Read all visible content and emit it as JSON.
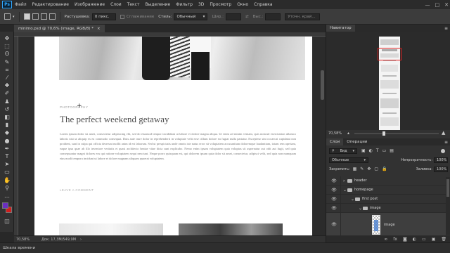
{
  "app": {
    "logo": "Ps"
  },
  "menu": [
    "Файл",
    "Редактирование",
    "Изображение",
    "Слои",
    "Текст",
    "Выделение",
    "Фильтр",
    "3D",
    "Просмотр",
    "Окно",
    "Справка"
  ],
  "window_controls": [
    "—",
    "□",
    "✕"
  ],
  "options_bar": {
    "feather_label": "Растушевка:",
    "feather_value": "0 пикс.",
    "antialias_label": "Сглаживание",
    "style_label": "Стиль:",
    "style_value": "Обычный",
    "width_label": "Шир.:",
    "height_label": "Выс.:",
    "refine_button": "Уточн. край..."
  },
  "document": {
    "tab_title": "minimo.psd @ 70,6% (image, RGB/8) *",
    "close_glyph": "×",
    "post_category": "PHOTOGRAPHY",
    "post_title": "The perfect weekend getaway",
    "post_body": "Lorem ipsum dolor sit amet, consectetur adipisicing elit, sed do eiusmod tempor incididunt ut labore et dolore magna aliqua. Ut enim ad minim veniam, quis nostrud exercitation ullamco laboris nisi ut aliquip ex ea commodo consequat. Duis aute irure dolor in reprehenderit in voluptate velit esse cillum dolore eu fugiat nulla pariatur. Excepteur sint occaecat cupidatat non proident, sunt in culpa qui officia deserunt mollit anim id est laborum. Sed ut perspiciatis unde omnis iste natus error sit voluptatem accusantium doloremque laudantium, totam rem aperiam, eaque ipsa quae ab illo inventore veritatis et quasi architecto beatae vitae dicta sunt explicabo. Nemo enim ipsam voluptatem quia voluptas sit aspernatur aut odit aut fugit, sed quia consequuntur magni dolores eos qui ratione voluptatem sequi nesciunt. Neque porro quisquam est, qui dolorem ipsum quia dolor sit amet, consectetur, adipisci velit, sed quia non numquam eius modi tempora incidunt ut labore et dolore magnam aliquam quaerat voluptatem.",
    "leave_comment": "LEAVE A COMMENT"
  },
  "status": {
    "zoom": "70,58%",
    "doc_size": "Док: 17,3M/549,9M",
    "arrow": "›"
  },
  "timeline": {
    "label": "Шкала времени"
  },
  "navigator": {
    "tab": "Навигатор",
    "zoom": "70,58%",
    "zoom_fraction": 0.35
  },
  "layers_panel": {
    "tabs": [
      "Слои",
      "Операции"
    ],
    "kind_filter": "Вид",
    "blend_mode": "Обычные",
    "opacity_label": "Непрозрачность:",
    "opacity_value": "100%",
    "lock_label": "Закрепить:",
    "fill_label": "Заливка:",
    "fill_value": "100%",
    "layers": [
      {
        "name": "header",
        "type": "folder",
        "indent": 0
      },
      {
        "name": "homepage",
        "type": "folder",
        "indent": 0
      },
      {
        "name": "first post",
        "type": "folder",
        "indent": 1
      },
      {
        "name": "image",
        "type": "folder",
        "indent": 2
      },
      {
        "name": "image",
        "type": "layer",
        "indent": 3
      }
    ],
    "footer_icons": [
      "link-icon",
      "fx-icon",
      "mask-icon",
      "adjustment-icon",
      "group-icon",
      "new-layer-icon",
      "trash-icon"
    ],
    "footer_glyphs": [
      "∞",
      "fx",
      "◙",
      "◐",
      "▭",
      "▣",
      "🗑"
    ]
  },
  "tools": [
    {
      "name": "move-tool",
      "glyph": "✥"
    },
    {
      "name": "marquee-tool",
      "glyph": "⬚"
    },
    {
      "name": "lasso-tool",
      "glyph": "ʘ"
    },
    {
      "name": "quick-select-tool",
      "glyph": "✎"
    },
    {
      "name": "crop-tool",
      "glyph": "⌗"
    },
    {
      "name": "eyedropper-tool",
      "glyph": "⁄"
    },
    {
      "name": "healing-tool",
      "glyph": "✚"
    },
    {
      "name": "brush-tool",
      "glyph": "✐"
    },
    {
      "name": "stamp-tool",
      "glyph": "♟"
    },
    {
      "name": "history-brush-tool",
      "glyph": "↺"
    },
    {
      "name": "eraser-tool",
      "glyph": "◧"
    },
    {
      "name": "gradient-tool",
      "glyph": "▮"
    },
    {
      "name": "blur-tool",
      "glyph": "◆"
    },
    {
      "name": "dodge-tool",
      "glyph": "●"
    },
    {
      "name": "pen-tool",
      "glyph": "✒"
    },
    {
      "name": "type-tool",
      "glyph": "T"
    },
    {
      "name": "path-select-tool",
      "glyph": "➤"
    },
    {
      "name": "shape-tool",
      "glyph": "▭"
    },
    {
      "name": "hand-tool",
      "glyph": "✋"
    },
    {
      "name": "zoom-tool",
      "glyph": "⚲"
    },
    {
      "name": "edit-toolbar",
      "glyph": "…"
    }
  ],
  "colors": {
    "foreground": "#6a2fbf",
    "background": "#d21c1c",
    "navigator_rect": "#e02020"
  }
}
